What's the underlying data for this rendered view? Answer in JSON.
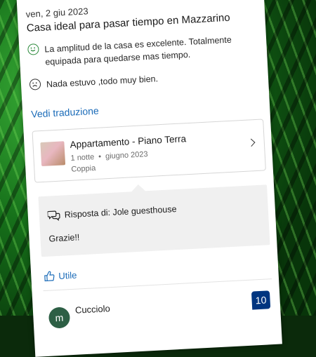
{
  "review": {
    "date": "ven, 2 giu 2023",
    "title": "Casa ideal para pasar tiempo en Mazzarino",
    "positive": "La amplitud de la casa es excelente. Totalmente equipada para quedarse mas tiempo.",
    "negative": "Nada estuvo ,todo muy bien.",
    "translate_label": "Vedi traduzione",
    "positive_icon": "smile-icon",
    "negative_icon": "frown-icon"
  },
  "stay": {
    "room_name": "Appartamento - Piano Terra",
    "nights": "1 notte",
    "month": "giugno 2023",
    "traveler_type": "Coppia",
    "chevron_icon": "chevron-right-icon"
  },
  "reply": {
    "label": "Risposta di: Jole guesthouse",
    "text": "Grazie!!",
    "icon": "speech-bubbles-icon"
  },
  "helpful": {
    "label": "Utile",
    "icon": "thumbs-up-icon"
  },
  "next_review": {
    "avatar_letter": "m",
    "name": "Cucciolo",
    "score": "10"
  },
  "colors": {
    "link": "#1a6bb8",
    "positive": "#2e8b3e",
    "score_bg": "#003580",
    "avatar_bg": "#2d5f45"
  }
}
